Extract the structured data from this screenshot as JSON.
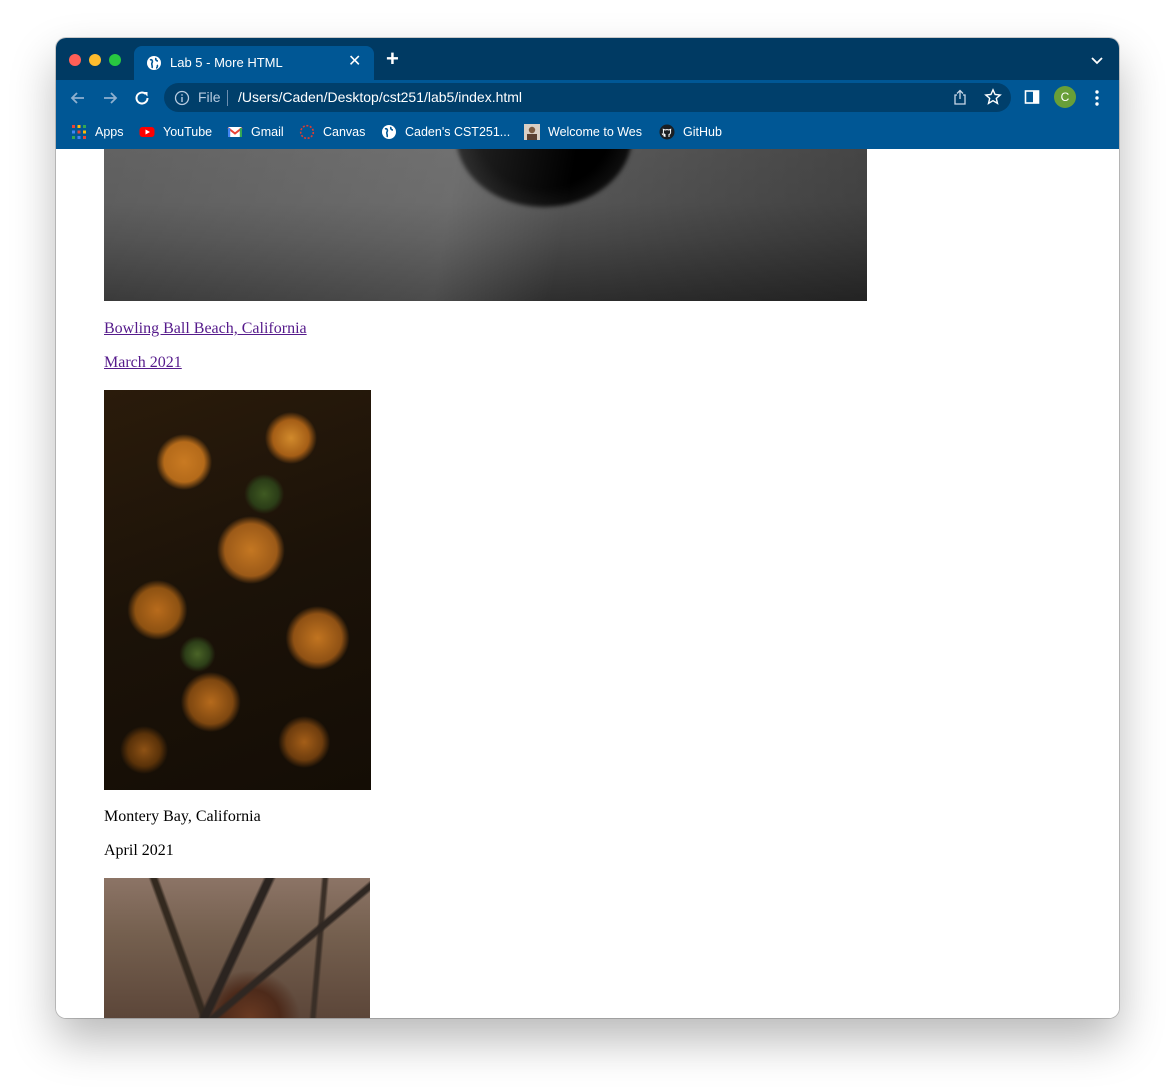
{
  "browser": {
    "tab": {
      "title": "Lab 5 - More HTML",
      "close_glyph": "✕",
      "favicon": "globe-icon"
    },
    "new_tab_glyph": "+",
    "omnibox": {
      "scheme": "File",
      "url": "/Users/Caden/Desktop/cst251/lab5/index.html"
    },
    "profile_initial": "C",
    "colors": {
      "tab_strip": "#003a63",
      "toolbar": "#005795",
      "omnibox": "#003f6b",
      "avatar": "#689f38"
    }
  },
  "bookmarks": [
    {
      "label": "Apps",
      "icon": "apps-grid-icon"
    },
    {
      "label": "YouTube",
      "icon": "youtube-icon"
    },
    {
      "label": "Gmail",
      "icon": "gmail-icon"
    },
    {
      "label": "Canvas",
      "icon": "canvas-icon"
    },
    {
      "label": "Caden's CST251...",
      "icon": "globe-icon"
    },
    {
      "label": "Welcome to Wes",
      "icon": "site-thumbnail-icon"
    },
    {
      "label": "GitHub",
      "icon": "github-icon"
    }
  ],
  "page": {
    "entries": [
      {
        "location": "Bowling Ball Beach, California",
        "date": "March 2021",
        "linked": true
      },
      {
        "location": "Montery Bay, California",
        "date": "April 2021",
        "linked": false
      }
    ],
    "link_color": "#551a8b"
  }
}
